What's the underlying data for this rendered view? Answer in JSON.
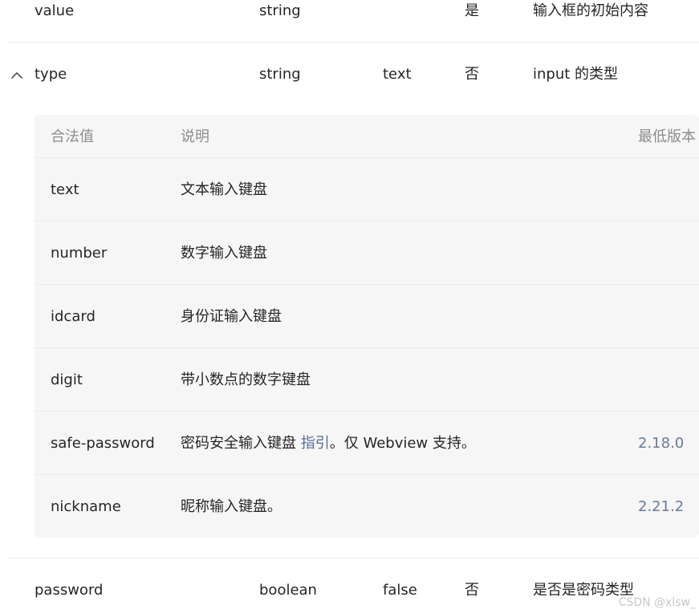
{
  "rows": {
    "value": {
      "name": "value",
      "type": "string",
      "default": "",
      "required": "是",
      "desc": "输入框的初始内容"
    },
    "type": {
      "name": "type",
      "type": "string",
      "default": "text",
      "required": "否",
      "desc": "input 的类型"
    },
    "password": {
      "name": "password",
      "type": "boolean",
      "default": "false",
      "required": "否",
      "desc": "是否是密码类型"
    }
  },
  "subtable": {
    "headers": {
      "value": "合法值",
      "desc": "说明",
      "version": "最低版本"
    },
    "items": [
      {
        "value": "text",
        "desc": "文本输入键盘",
        "version": ""
      },
      {
        "value": "number",
        "desc": "数字输入键盘",
        "version": ""
      },
      {
        "value": "idcard",
        "desc": "身份证输入键盘",
        "version": ""
      },
      {
        "value": "digit",
        "desc": "带小数点的数字键盘",
        "version": ""
      },
      {
        "value": "safe-password",
        "desc_before": "密码安全输入键盘 ",
        "desc_link": "指引",
        "desc_after": "。仅 Webview 支持。",
        "version": "2.18.0"
      },
      {
        "value": "nickname",
        "desc": "昵称输入键盘。",
        "version": "2.21.2"
      }
    ]
  },
  "icons": {
    "toggle": "chevron-up-icon"
  },
  "colors": {
    "link": "#576b95",
    "version": "#6b7a99",
    "panel": "#f6f6f6"
  },
  "watermark": "CSDN @xlsw_"
}
